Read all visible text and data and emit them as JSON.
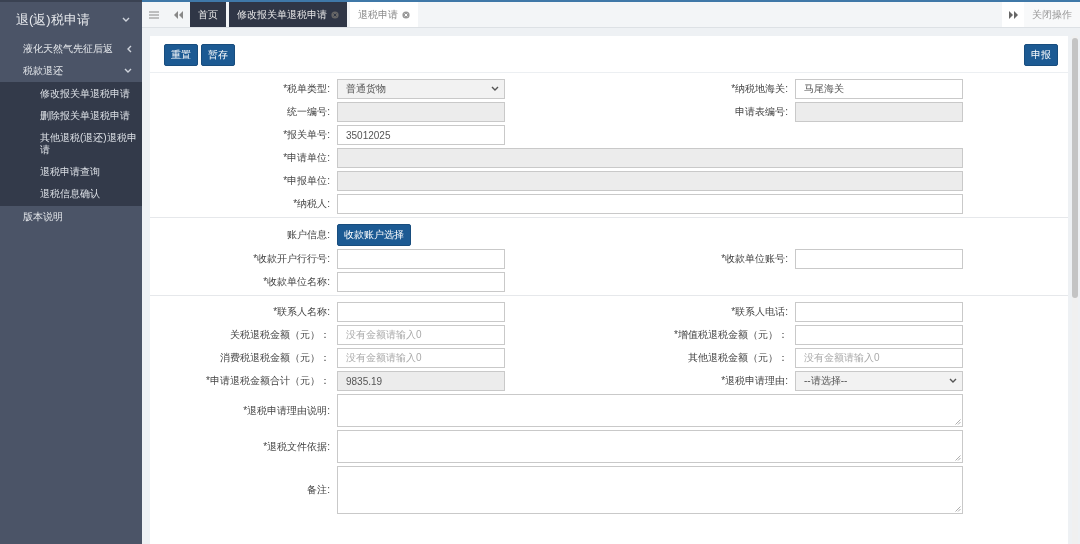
{
  "sidebar": {
    "title": "退(返)税申请",
    "expanded": true,
    "items": [
      {
        "label": "液化天然气先征后返",
        "expanded": false
      },
      {
        "label": "税款退还",
        "expanded": true,
        "children": [
          {
            "label": "修改报关单退税申请",
            "selected": false
          },
          {
            "label": "删除报关单退税申请",
            "selected": false
          },
          {
            "label": "其他退税(退还)退税申请",
            "selected": false
          },
          {
            "label": "退税申请查询",
            "selected": false
          },
          {
            "label": "退税信息确认",
            "selected": false
          }
        ]
      },
      {
        "label": "版本说明"
      }
    ]
  },
  "tabs": [
    {
      "label": "首页",
      "selected": false,
      "closable": false
    },
    {
      "label": "修改报关单退税申请",
      "selected": false,
      "closable": true
    },
    {
      "label": "退税申请",
      "selected": true,
      "closable": true
    }
  ],
  "tab_actions": {
    "close_label": "关闭操作"
  },
  "toolbar": {
    "left_buttons": [
      "重置",
      "暂存"
    ],
    "right_buttons": [
      "申报"
    ]
  },
  "form": {
    "sections": [
      {
        "rows": [
          [
            {
              "label": "*税单类型:",
              "kind": "select",
              "value": "普通货物"
            },
            {
              "label": "*纳税地海关:",
              "kind": "input",
              "value": "马尾海关"
            }
          ],
          [
            {
              "label": "统一编号:",
              "kind": "input",
              "disabled": true
            },
            {
              "label": "申请表编号:",
              "kind": "input",
              "disabled": true
            }
          ],
          [
            {
              "label": "*报关单号:",
              "kind": "input",
              "value": "35012025"
            }
          ],
          [
            {
              "label": "*申请单位:",
              "kind": "input",
              "disabled": true,
              "wide": true
            }
          ],
          [
            {
              "label": "*申报单位:",
              "kind": "input",
              "disabled": true,
              "wide": true
            }
          ],
          [
            {
              "label": "*纳税人:",
              "kind": "input",
              "wide": true
            }
          ]
        ]
      },
      {
        "rows": [
          [
            {
              "label": "账户信息:",
              "kind": "button",
              "value": "收款账户选择"
            }
          ],
          [
            {
              "label": "*收款开户行行号:",
              "kind": "input"
            },
            {
              "label": "*收款单位账号:",
              "kind": "input"
            }
          ],
          [
            {
              "label": "*收款单位名称:",
              "kind": "input"
            }
          ]
        ]
      },
      {
        "rows": [
          [
            {
              "label": "*联系人名称:",
              "kind": "input"
            },
            {
              "label": "*联系人电话:",
              "kind": "input"
            }
          ],
          [
            {
              "label": "关税退税金额（元）：",
              "kind": "input",
              "placeholder": "没有金额请输入0"
            },
            {
              "label": "*增值税退税金额（元）：",
              "kind": "input"
            }
          ],
          [
            {
              "label": "消费税退税金额（元）：",
              "kind": "input",
              "placeholder": "没有金额请输入0"
            },
            {
              "label": "其他退税金额（元）：",
              "kind": "input",
              "placeholder": "没有金额请输入0"
            }
          ],
          [
            {
              "label": "*申请退税金额合计（元）：",
              "kind": "input",
              "disabled": true,
              "value": "9835.19"
            },
            {
              "label": "*退税申请理由:",
              "kind": "select",
              "value": "--请选择--"
            }
          ],
          [
            {
              "label": "*退税申请理由说明:",
              "kind": "textarea",
              "wide": true
            }
          ],
          [
            {
              "label": "*退税文件依据:",
              "kind": "textarea",
              "wide": true
            }
          ],
          [
            {
              "label": "备注:",
              "kind": "textarea",
              "wide": true,
              "tall": true
            }
          ]
        ]
      }
    ]
  }
}
